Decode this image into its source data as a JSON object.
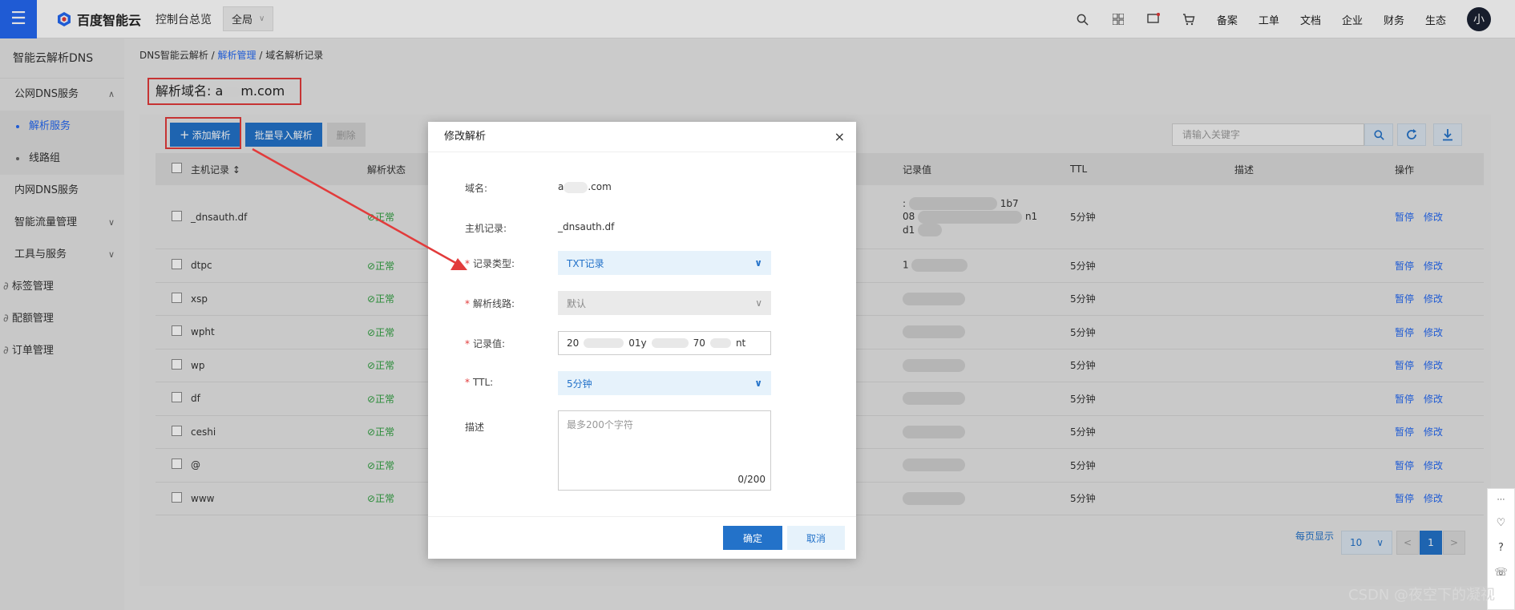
{
  "topbar": {
    "brand": "百度智能云",
    "console": "控制台总览",
    "region": "全局",
    "links": [
      "备案",
      "工单",
      "文档",
      "企业",
      "财务",
      "生态"
    ],
    "avatar": "小"
  },
  "sidebar": {
    "title": "智能云解析DNS",
    "public_dns": "公网DNS服务",
    "resolve_service": "解析服务",
    "line_group": "线路组",
    "intranet_dns": "内网DNS服务",
    "traffic": "智能流量管理",
    "tools": "工具与服务",
    "tags": "标签管理",
    "quota": "配额管理",
    "orders": "订单管理"
  },
  "breadcrumb": {
    "root": "DNS智能云解析",
    "sep": "/",
    "manage": "解析管理",
    "current": "域名解析记录"
  },
  "domain": {
    "label": "解析域名:",
    "prefix": "a",
    "suffix": "m.com"
  },
  "toolbar": {
    "add": "添加解析",
    "bulk_import": "批量导入解析",
    "delete": "删除",
    "search_placeholder": "请输入关键字"
  },
  "table": {
    "headers": [
      "主机记录",
      "解析状态",
      "记录值",
      "TTL",
      "描述",
      "操作"
    ],
    "rows": [
      {
        "host": "_dnsauth.df",
        "status": "正常",
        "value_parts": [
          ":",
          "1b7",
          "08",
          "n1",
          "d1"
        ],
        "ttl": "5分钟"
      },
      {
        "host": "dtpc",
        "status": "正常",
        "value_parts": [
          "1"
        ],
        "ttl": "5分钟"
      },
      {
        "host": "xsp",
        "status": "正常",
        "value_parts": [],
        "ttl": "5分钟"
      },
      {
        "host": "wpht",
        "status": "正常",
        "value_parts": [],
        "ttl": "5分钟"
      },
      {
        "host": "wp",
        "status": "正常",
        "value_parts": [],
        "ttl": "5分钟"
      },
      {
        "host": "df",
        "status": "正常",
        "value_parts": [],
        "ttl": "5分钟"
      },
      {
        "host": "ceshi",
        "status": "正常",
        "value_parts": [],
        "ttl": "5分钟"
      },
      {
        "host": "@",
        "status": "正常",
        "value_parts": [],
        "ttl": "5分钟"
      },
      {
        "host": "www",
        "status": "正常",
        "value_parts": [],
        "ttl": "5分钟"
      }
    ],
    "op_pause": "暂停",
    "op_edit": "修改"
  },
  "pager": {
    "per_page_label": "每页显示",
    "per_page": "10",
    "prev": "<",
    "current": "1",
    "next": ">"
  },
  "modal": {
    "title": "修改解析",
    "close": "×",
    "domain_label": "域名:",
    "domain_prefix": "a",
    "domain_suffix": ".com",
    "host_label": "主机记录:",
    "host_value": "_dnsauth.df",
    "type_label": "记录类型:",
    "type_value": "TXT记录",
    "line_label": "解析线路:",
    "line_value": "默认",
    "value_label": "记录值:",
    "value_parts": [
      "20",
      "01y",
      "70",
      "nt"
    ],
    "ttl_label": "TTL:",
    "ttl_value": "5分钟",
    "desc_label": "描述",
    "desc_placeholder": "最多200个字符",
    "desc_count": "0/200",
    "ok": "确定",
    "cancel": "取消"
  },
  "watermark": "CSDN @夜空下的凝视",
  "colors": {
    "accent": "#2372c9",
    "highlight_red": "#e23b3b",
    "ok_green": "#2e9e3e"
  }
}
